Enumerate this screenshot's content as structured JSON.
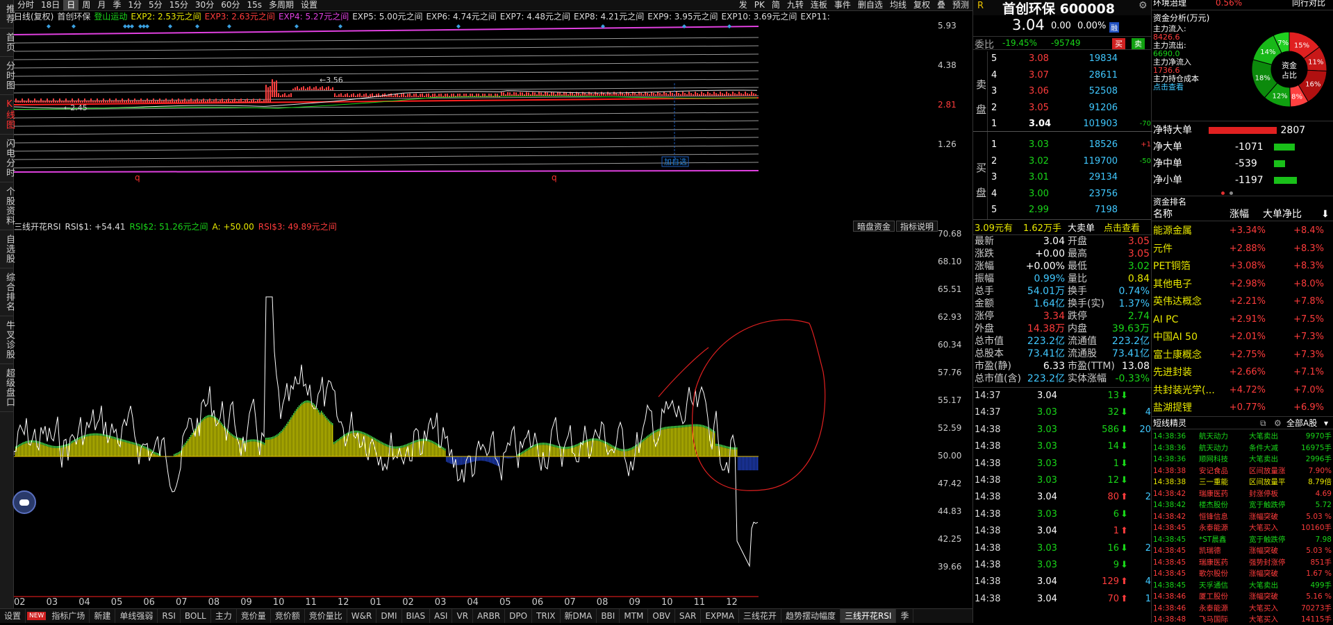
{
  "leftbar": [
    "推荐",
    "首页",
    "分时图",
    "K线图",
    "闪电分时",
    "个股资料",
    "自选股",
    "综合排名",
    "牛叉诊股",
    "超级盘口"
  ],
  "topbar": {
    "left": [
      "分时",
      "18日",
      "日",
      "周",
      "月",
      "季",
      "1分",
      "5分",
      "15分",
      "30分",
      "60分",
      "15s",
      "多周期",
      "设置"
    ],
    "right": [
      "发",
      "PK",
      "简",
      "九转",
      "连板",
      "事件",
      "删自选",
      "均线",
      "复权",
      "叠",
      "预测"
    ]
  },
  "infoline": [
    {
      "t": "日线(复权)",
      "c": "#ddd"
    },
    {
      "t": "首创环保",
      "c": "#ddd"
    },
    {
      "t": "登山运动",
      "c": "#19d619"
    },
    {
      "t": "EXP2: 2.53元之间",
      "c": "#e8e800"
    },
    {
      "t": "EXP3: 2.63元之间",
      "c": "#ff3c3c"
    },
    {
      "t": "EXP4: 5.27元之间",
      "c": "#e040e0"
    },
    {
      "t": "EXP5: 5.00元之间",
      "c": "#ddd"
    },
    {
      "t": "EXP6: 4.74元之间",
      "c": "#ddd"
    },
    {
      "t": "EXP7: 4.48元之间",
      "c": "#ddd"
    },
    {
      "t": "EXP8: 4.21元之间",
      "c": "#ddd"
    },
    {
      "t": "EXP9: 3.95元之间",
      "c": "#ddd"
    },
    {
      "t": "EXP10: 3.69元之间",
      "c": "#ddd"
    },
    {
      "t": "EXP11:",
      "c": "#ddd"
    }
  ],
  "main_axis": [
    "5.93",
    "4.38",
    "2.81",
    "1.26"
  ],
  "main_labels": {
    "high": "3.56",
    "low": "2.45",
    "addfav": "加自选",
    "q": "q"
  },
  "rsi": {
    "line": [
      {
        "t": "三线开花RSI",
        "c": "#ddd"
      },
      {
        "t": "RSI$1: +54.41",
        "c": "#ddd"
      },
      {
        "t": "RSI$2: 51.26元之间",
        "c": "#19d619"
      },
      {
        "t": "A: +50.00",
        "c": "#e8e800"
      },
      {
        "t": "RSI$3: 49.89元之间",
        "c": "#ff3c3c"
      }
    ],
    "btn1": "暗盘资金",
    "btn2": "指标说明",
    "axis": [
      "70.68",
      "68.10",
      "65.51",
      "62.93",
      "60.34",
      "57.76",
      "55.17",
      "52.59",
      "50.00",
      "47.42",
      "44.83",
      "42.25",
      "39.66"
    ]
  },
  "xaxis": [
    "02",
    "03",
    "04",
    "05",
    "06",
    "07",
    "08",
    "09",
    "10",
    "11",
    "12",
    "01",
    "02",
    "03",
    "04",
    "05",
    "06",
    "07",
    "08",
    "09",
    "10",
    "11",
    "12"
  ],
  "bottomtabs": [
    "设置",
    "NEW",
    "指标广场",
    "新建",
    "单线强弱",
    "RSI",
    "BOLL",
    "主力",
    "竞价量",
    "竞价额",
    "竞价量比",
    "W&R",
    "DMI",
    "BIAS",
    "ASI",
    "VR",
    "ARBR",
    "DPO",
    "TRIX",
    "新DMA",
    "BBI",
    "MTM",
    "OBV",
    "SAR",
    "EXPMA",
    "三线花开",
    "趋势摆动幅度",
    "三线开花RSI",
    "季"
  ],
  "stock": {
    "name": "首创环保 600008",
    "price": "3.04",
    "chg": "0.00",
    "pct": "0.00%",
    "tag": "融"
  },
  "weibi": {
    "label": "委比",
    "pct": "-19.45%",
    "diff": "-95749",
    "buy": "买",
    "sell": "卖"
  },
  "asks": [
    [
      "5",
      "3.08",
      "19834",
      ""
    ],
    [
      "4",
      "3.07",
      "28611",
      ""
    ],
    [
      "3",
      "3.06",
      "52508",
      ""
    ],
    [
      "2",
      "3.05",
      "91206",
      ""
    ],
    [
      "1",
      "3.04",
      "101903",
      "-70"
    ]
  ],
  "bids": [
    [
      "1",
      "3.03",
      "18526",
      "+1"
    ],
    [
      "2",
      "3.02",
      "119700",
      "-50"
    ],
    [
      "3",
      "3.01",
      "29134",
      ""
    ],
    [
      "4",
      "3.00",
      "23756",
      ""
    ],
    [
      "5",
      "2.99",
      "7198",
      ""
    ]
  ],
  "side_labels": {
    "sell": "卖盘",
    "buy": "买盘"
  },
  "bigorder": {
    "price": "3.09元有",
    "vol": "1.62万手",
    "label": "大卖单",
    "link": "点击查看"
  },
  "quote": [
    [
      "最新",
      "3.04",
      "开盘",
      "3.05",
      "white",
      "red"
    ],
    [
      "涨跌",
      "+0.00",
      "最高",
      "3.05",
      "white",
      "red"
    ],
    [
      "涨幅",
      "+0.00%",
      "最低",
      "3.02",
      "white",
      "green"
    ],
    [
      "振幅",
      "0.99%",
      "量比",
      "0.84",
      "cyan",
      "yellow"
    ],
    [
      "总手",
      "54.01万",
      "换手",
      "0.74%",
      "cyan",
      "cyan"
    ],
    [
      "金额",
      "1.64亿",
      "换手(实)",
      "1.37%",
      "cyan",
      "cyan"
    ],
    [
      "涨停",
      "3.34",
      "跌停",
      "2.74",
      "red",
      "green"
    ],
    [
      "外盘",
      "14.38万",
      "内盘",
      "39.63万",
      "red",
      "green"
    ],
    [
      "总市值",
      "223.2亿",
      "流通值",
      "223.2亿",
      "cyan",
      "cyan"
    ],
    [
      "总股本",
      "73.41亿",
      "流通股",
      "73.41亿",
      "cyan",
      "cyan"
    ],
    [
      "市盈(静)",
      "6.33",
      "市盈(TTM)",
      "13.08",
      "white",
      "white"
    ],
    [
      "总市值(含)",
      "223.2亿",
      "实体涨幅",
      "-0.33%",
      "cyan",
      "green"
    ]
  ],
  "ticks": [
    [
      "14:37",
      "3.04",
      "13",
      "down",
      ""
    ],
    [
      "14:37",
      "3.03",
      "32",
      "down",
      "4"
    ],
    [
      "14:38",
      "3.03",
      "586",
      "down",
      "20"
    ],
    [
      "14:38",
      "3.03",
      "14",
      "down",
      ""
    ],
    [
      "14:38",
      "3.03",
      "1",
      "down",
      ""
    ],
    [
      "14:38",
      "3.03",
      "12",
      "down",
      ""
    ],
    [
      "14:38",
      "3.04",
      "80",
      "up",
      "2"
    ],
    [
      "14:38",
      "3.03",
      "6",
      "down",
      ""
    ],
    [
      "14:38",
      "3.04",
      "1",
      "up",
      ""
    ],
    [
      "14:38",
      "3.03",
      "16",
      "down",
      "2"
    ],
    [
      "14:38",
      "3.03",
      "9",
      "down",
      ""
    ],
    [
      "14:38",
      "3.04",
      "129",
      "up",
      "4"
    ],
    [
      "14:38",
      "3.04",
      "70",
      "up",
      "1"
    ]
  ],
  "right": {
    "top": {
      "title": "环境治理",
      "pct": "0.56%",
      "rightlabel": "同行对比"
    },
    "fund": {
      "title": "资金分析(万元)",
      "inflow_label": "主力流入:",
      "inflow": "8426.6",
      "outflow_label": "主力流出:",
      "outflow": "6690.0",
      "net_label": "主力净流入",
      "net": "1736.6",
      "cost_label": "主力持仓成本",
      "link": "点击查看",
      "center1": "资金",
      "center2": "占比",
      "pie": [
        {
          "v": 15,
          "c": "#e02020",
          "l": "15%"
        },
        {
          "v": 11,
          "c": "#c81818",
          "l": "11%"
        },
        {
          "v": 16,
          "c": "#b01010",
          "l": "16%"
        },
        {
          "v": 8,
          "c": "#ff4040",
          "l": "8%"
        },
        {
          "v": 12,
          "c": "#10a010",
          "l": "12%"
        },
        {
          "v": 18,
          "c": "#0c8a0c",
          "l": "18%"
        },
        {
          "v": 14,
          "c": "#18b818",
          "l": "14%"
        },
        {
          "v": 7,
          "c": "#20d020",
          "l": "7%"
        }
      ]
    },
    "net": [
      {
        "label": "净特大单",
        "val": "2807",
        "color": "#e02020",
        "frac": 0.75
      },
      {
        "label": "净大单",
        "val": "-1071",
        "color": "#19c019",
        "frac": 0.3
      },
      {
        "label": "净中单",
        "val": "-539",
        "color": "#19c019",
        "frac": 0.16
      },
      {
        "label": "净小单",
        "val": "-1197",
        "color": "#19c019",
        "frac": 0.33
      }
    ],
    "rank": {
      "title": "资金排名",
      "h1": "名称",
      "h2": "涨幅",
      "h3": "大单净比",
      "rows": [
        [
          "能源金属",
          "+3.34%",
          "+8.4%"
        ],
        [
          "元件",
          "+2.88%",
          "+8.3%"
        ],
        [
          "PET铜箔",
          "+3.08%",
          "+8.3%"
        ],
        [
          "其他电子",
          "+2.98%",
          "+8.0%"
        ],
        [
          "英伟达概念",
          "+2.21%",
          "+7.8%"
        ],
        [
          "AI PC",
          "+2.91%",
          "+7.5%"
        ],
        [
          "中国AI 50",
          "+2.01%",
          "+7.3%"
        ],
        [
          "富士康概念",
          "+2.75%",
          "+7.3%"
        ],
        [
          "先进封装",
          "+2.66%",
          "+7.1%"
        ],
        [
          "共封装光学(...",
          "+4.72%",
          "+7.0%"
        ],
        [
          "盐湖提锂",
          "+0.77%",
          "+6.9%"
        ]
      ]
    },
    "elf": {
      "title": "短线精灵",
      "filter": "全部A股",
      "rows": [
        [
          "14:38:36",
          "航天动力",
          "大笔卖出",
          "9970手",
          "green"
        ],
        [
          "14:38:36",
          "航天动力",
          "条件大减",
          "16975手",
          "green"
        ],
        [
          "14:38:36",
          "顺网科技",
          "大笔卖出",
          "2996手",
          "green"
        ],
        [
          "14:38:38",
          "安记食品",
          "区间放量涨",
          "7.90%",
          "red"
        ],
        [
          "14:38:38",
          "三一重能",
          "区间放量平",
          "8.79倍",
          "yellow"
        ],
        [
          "14:38:42",
          "瑞康医药",
          "封涨停板",
          "4.69",
          "red"
        ],
        [
          "14:38:42",
          "楼杰股份",
          "宽于触跌停",
          "5.72",
          "green"
        ],
        [
          "14:38:42",
          "恒锋信息",
          "涨幅突破",
          "5.03 %",
          "red"
        ],
        [
          "14:38:45",
          "永泰能源",
          "大笔买入",
          "10160手",
          "red"
        ],
        [
          "14:38:45",
          "*ST晨鑫",
          "宽于触跌停",
          "7.98",
          "green"
        ],
        [
          "14:38:45",
          "凯瑞德",
          "涨幅突破",
          "5.03 %",
          "red"
        ],
        [
          "14:38:45",
          "瑞康医药",
          "强势封涨停",
          "851手",
          "red"
        ],
        [
          "14:38:45",
          "歌尔股份",
          "涨幅突破",
          "1.67 %",
          "red"
        ],
        [
          "14:38:45",
          "天孚通信",
          "大笔卖出",
          "499手",
          "green"
        ],
        [
          "14:38:46",
          "厦工股份",
          "涨幅突破",
          "5.16 %",
          "red"
        ],
        [
          "14:38:46",
          "永泰能源",
          "大笔买入",
          "70273手",
          "red"
        ],
        [
          "14:38:48",
          "飞马国际",
          "大笔买入",
          "14115手",
          "red"
        ]
      ]
    }
  }
}
